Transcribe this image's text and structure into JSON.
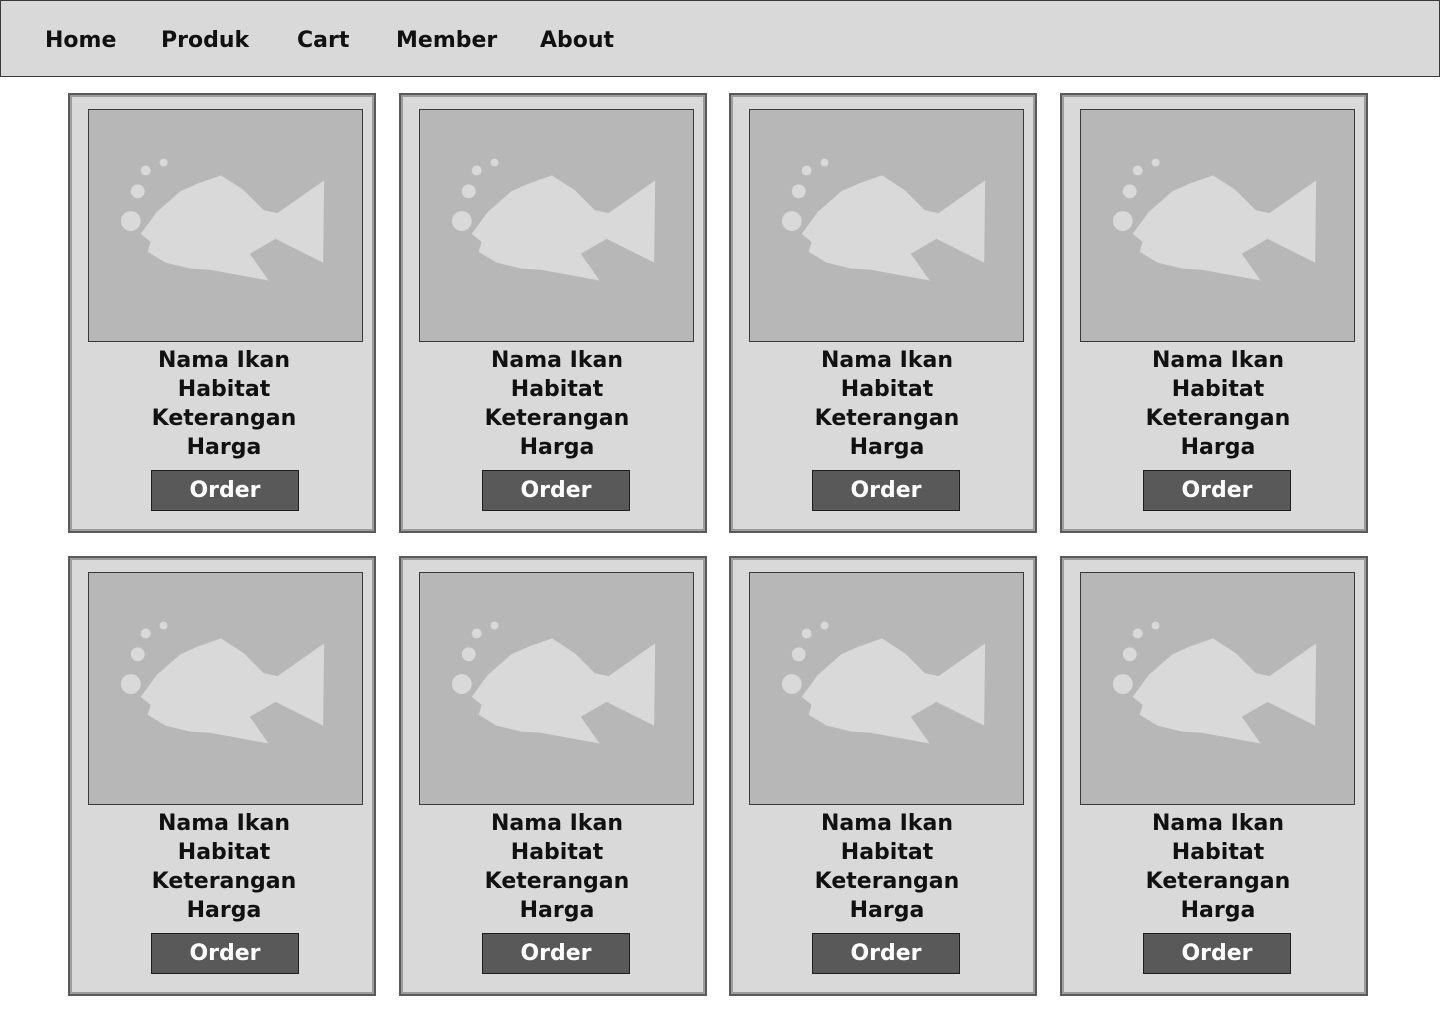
{
  "nav": {
    "items": [
      {
        "label": "Home"
      },
      {
        "label": "Produk"
      },
      {
        "label": "Cart"
      },
      {
        "label": "Member"
      },
      {
        "label": "About"
      }
    ]
  },
  "products": [
    {
      "name": "Nama Ikan",
      "habitat": "Habitat",
      "description": "Keterangan",
      "price": "Harga",
      "order_label": "Order",
      "image_icon": "fish-image-placeholder-icon"
    },
    {
      "name": "Nama Ikan",
      "habitat": "Habitat",
      "description": "Keterangan",
      "price": "Harga",
      "order_label": "Order",
      "image_icon": "fish-image-placeholder-icon"
    },
    {
      "name": "Nama Ikan",
      "habitat": "Habitat",
      "description": "Keterangan",
      "price": "Harga",
      "order_label": "Order",
      "image_icon": "fish-image-placeholder-icon"
    },
    {
      "name": "Nama Ikan",
      "habitat": "Habitat",
      "description": "Keterangan",
      "price": "Harga",
      "order_label": "Order",
      "image_icon": "fish-image-placeholder-icon"
    },
    {
      "name": "Nama Ikan",
      "habitat": "Habitat",
      "description": "Keterangan",
      "price": "Harga",
      "order_label": "Order",
      "image_icon": "fish-image-placeholder-icon"
    },
    {
      "name": "Nama Ikan",
      "habitat": "Habitat",
      "description": "Keterangan",
      "price": "Harga",
      "order_label": "Order",
      "image_icon": "fish-image-placeholder-icon"
    },
    {
      "name": "Nama Ikan",
      "habitat": "Habitat",
      "description": "Keterangan",
      "price": "Harga",
      "order_label": "Order",
      "image_icon": "fish-image-placeholder-icon"
    },
    {
      "name": "Nama Ikan",
      "habitat": "Habitat",
      "description": "Keterangan",
      "price": "Harga",
      "order_label": "Order",
      "image_icon": "fish-image-placeholder-icon"
    }
  ],
  "colors": {
    "nav_background": "#d9d9d9",
    "card_background": "#d9d9d9",
    "image_placeholder": "#b7b7b7",
    "fish_silhouette": "#d9d9d9",
    "button_background": "#595959",
    "button_text": "#ffffff"
  }
}
